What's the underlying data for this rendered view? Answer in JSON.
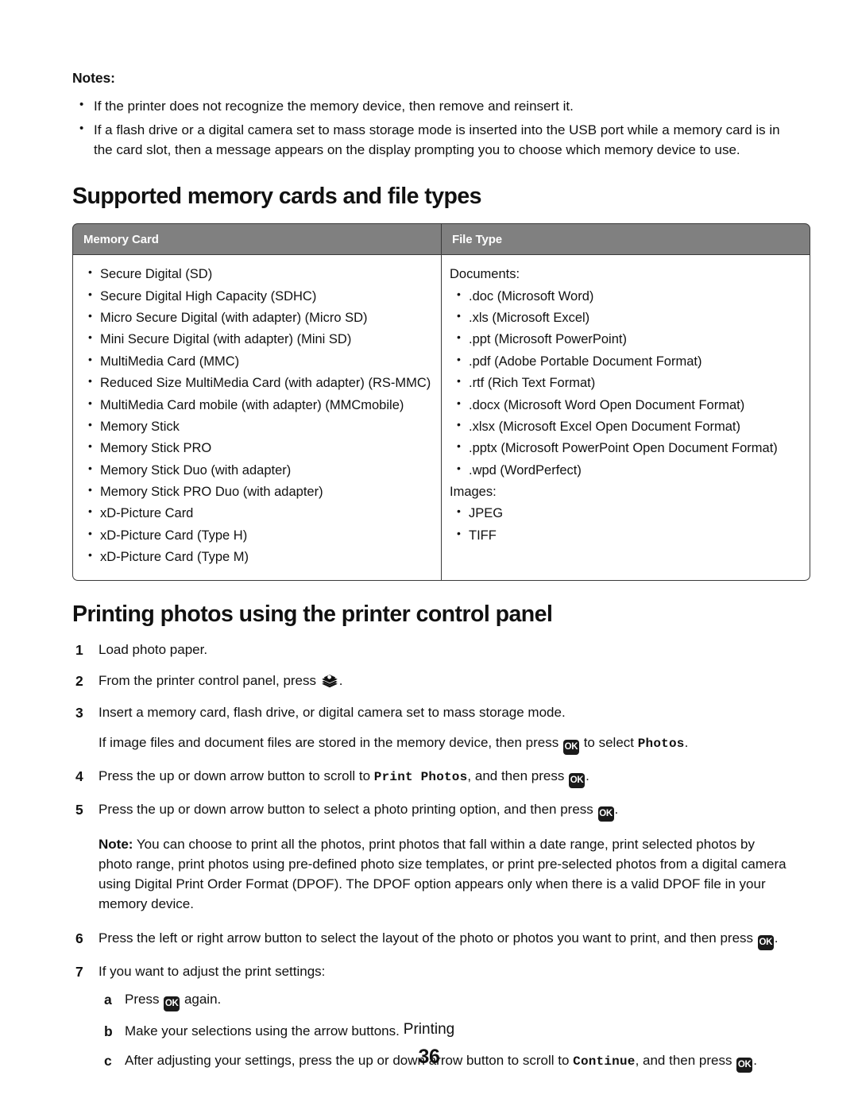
{
  "notes": {
    "label": "Notes:",
    "items": [
      "If the printer does not recognize the memory device, then remove and reinsert it.",
      "If a flash drive or a digital camera set to mass storage mode is inserted into the USB port while a memory card is in the card slot, then a message appears on the display prompting you to choose which memory device to use."
    ]
  },
  "section1": {
    "heading": "Supported memory cards and file types",
    "table": {
      "headers": {
        "memory_card": "Memory Card",
        "file_type": "File Type"
      },
      "memory_cards": [
        "Secure Digital (SD)",
        "Secure Digital High Capacity (SDHC)",
        "Micro Secure Digital (with adapter) (Micro SD)",
        "Mini Secure Digital (with adapter) (Mini SD)",
        "MultiMedia Card (MMC)",
        "Reduced Size MultiMedia Card (with adapter) (RS-MMC)",
        "MultiMedia Card mobile (with adapter) (MMCmobile)",
        "Memory Stick",
        "Memory Stick PRO",
        "Memory Stick Duo (with adapter)",
        "Memory Stick PRO Duo (with adapter)",
        "xD-Picture Card",
        "xD-Picture Card (Type H)",
        "xD-Picture Card (Type M)"
      ],
      "file_types": {
        "documents_label": "Documents:",
        "documents": [
          ".doc (Microsoft Word)",
          ".xls (Microsoft Excel)",
          ".ppt (Microsoft PowerPoint)",
          ".pdf (Adobe Portable Document Format)",
          ".rtf (Rich Text Format)",
          ".docx (Microsoft Word Open Document Format)",
          ".xlsx (Microsoft Excel Open Document Format)",
          ".pptx (Microsoft PowerPoint Open Document Format)",
          ".wpd (WordPerfect)"
        ],
        "images_label": "Images:",
        "images": [
          "JPEG",
          "TIFF"
        ]
      }
    }
  },
  "section2": {
    "heading": "Printing photos using the printer control panel",
    "step1": {
      "num": "1",
      "text": "Load photo paper."
    },
    "step2": {
      "num": "2",
      "text_before": "From the printer control panel, press",
      "icon": "photo-card-icon",
      "text_after": "."
    },
    "step3": {
      "num": "3",
      "text": "Insert a memory card, flash drive, or digital camera set to mass storage mode.",
      "cont_before": "If image files and document files are stored in the memory device, then press",
      "ok_label": "OK",
      "cont_mid": "to select",
      "menu_name": "Photos",
      "cont_after": "."
    },
    "step4": {
      "num": "4",
      "text_before": "Press the up or down arrow button to scroll to",
      "menu_name": "Print Photos",
      "text_mid": ", and then press",
      "ok_label": "OK",
      "text_after": "."
    },
    "step5": {
      "num": "5",
      "text_before": "Press the up or down arrow button to select a photo printing option, and then press",
      "ok_label": "OK",
      "text_after": "."
    },
    "note": {
      "lead": "Note:",
      "body": " You can choose to print all the photos, print photos that fall within a date range, print selected photos by photo range, print photos using pre-defined photo size templates, or print pre-selected photos from a digital camera using Digital Print Order Format (DPOF). The DPOF option appears only when there is a valid DPOF file in your memory device."
    },
    "step6": {
      "num": "6",
      "text_before": "Press the left or right arrow button to select the layout of the photo or photos you want to print, and then press",
      "ok_label": "OK",
      "text_after": "."
    },
    "step7": {
      "num": "7",
      "text": "If you want to adjust the print settings:",
      "substeps": {
        "a": {
          "letter": "a",
          "text_before": "Press",
          "ok_label": "OK",
          "text_after": "again."
        },
        "b": {
          "letter": "b",
          "text": "Make your selections using the arrow buttons."
        },
        "c": {
          "letter": "c",
          "text_before": "After adjusting your settings, press the up or down arrow button to scroll to",
          "menu_name": "Continue",
          "text_mid": ", and then press",
          "ok_label": "OK",
          "text_after": "."
        }
      }
    }
  },
  "footer": {
    "title": "Printing",
    "page_number": "36"
  },
  "colors": {
    "table_header_bg": "#808080",
    "table_border": "#3a3a3a",
    "key_bg": "#1a1a1a",
    "text": "#111111"
  }
}
